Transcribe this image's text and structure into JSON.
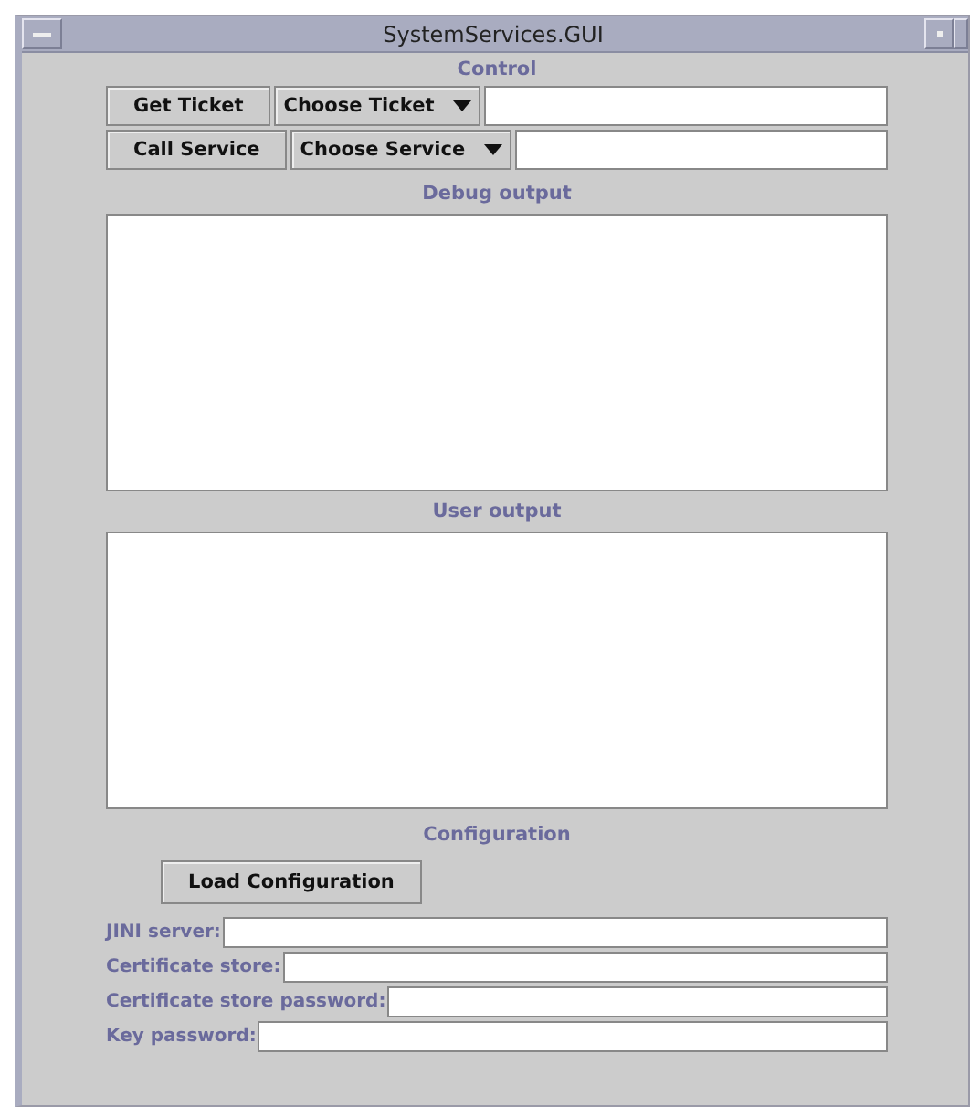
{
  "window": {
    "title": "SystemServices.GUI"
  },
  "control": {
    "heading": "Control",
    "rows": [
      {
        "button": "Get Ticket",
        "dropdown": "Choose Ticket"
      },
      {
        "button": "Call Service",
        "dropdown": "Choose Service"
      }
    ]
  },
  "debug_output": {
    "heading": "Debug output"
  },
  "user_output": {
    "heading": "User output"
  },
  "configuration": {
    "heading": "Configuration",
    "button": "Load Configuration",
    "fields": [
      {
        "label": "JINI server:"
      },
      {
        "label": "Certificate store:"
      },
      {
        "label": "Certificate store password:"
      },
      {
        "label": "Key password:"
      }
    ]
  }
}
